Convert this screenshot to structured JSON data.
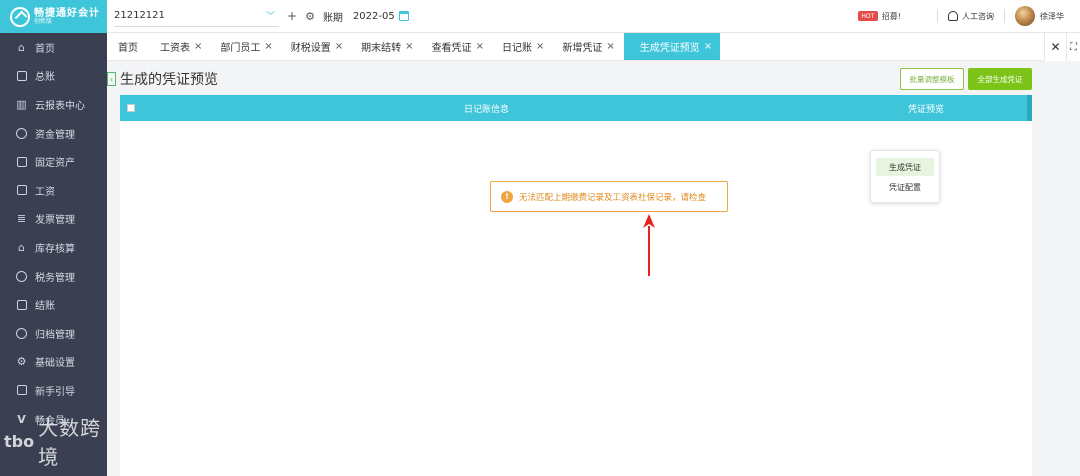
{
  "app": {
    "title": "畅捷通好会计",
    "subtitle": "创新版"
  },
  "sidebar": {
    "items": [
      {
        "label": "首页",
        "icon": "home-icon"
      },
      {
        "label": "总账",
        "icon": "ledger-icon"
      },
      {
        "label": "云报表中心",
        "icon": "chart-icon"
      },
      {
        "label": "资金管理",
        "icon": "money-icon"
      },
      {
        "label": "固定资产",
        "icon": "asset-icon"
      },
      {
        "label": "工资",
        "icon": "salary-icon"
      },
      {
        "label": "发票管理",
        "icon": "invoice-icon"
      },
      {
        "label": "库存核算",
        "icon": "warehouse-icon"
      },
      {
        "label": "税务管理",
        "icon": "tax-icon"
      },
      {
        "label": "结账",
        "icon": "checkout-icon"
      },
      {
        "label": "归档管理",
        "icon": "archive-icon"
      },
      {
        "label": "基础设置",
        "icon": "settings-icon"
      },
      {
        "label": "新手引导",
        "icon": "guide-icon"
      },
      {
        "label": "畅会员",
        "icon": "member-icon"
      }
    ]
  },
  "topbar": {
    "company": "21212121",
    "period_label": "账期",
    "period_value": "2022-05",
    "recruit_badge": "HOT",
    "recruit_label": "招募!",
    "support_label": "人工咨询",
    "user_name": "徐泽华"
  },
  "tabs": [
    {
      "label": "首页",
      "closable": false
    },
    {
      "label": "工资表",
      "closable": true
    },
    {
      "label": "部门员工",
      "closable": true
    },
    {
      "label": "财税设置",
      "closable": true
    },
    {
      "label": "期末结转",
      "closable": true
    },
    {
      "label": "查看凭证",
      "closable": true
    },
    {
      "label": "日记账",
      "closable": true
    },
    {
      "label": "新增凭证",
      "closable": true
    },
    {
      "label": "生成凭证预览",
      "closable": true,
      "active": true
    }
  ],
  "page": {
    "title": "生成的凭证预览",
    "btn_batch": "批量调整模板",
    "btn_all": "全部生成凭证",
    "table_headers": [
      "日记账信息",
      "凭证预览"
    ],
    "warning": "无法匹配上期缴费记录及工资表社保记录，请检查",
    "dropdown": [
      "生成凭证",
      "凭证配置"
    ]
  },
  "watermark": {
    "logo": "tbo",
    "text": "大数跨境"
  },
  "colors": {
    "accent": "#3ec5da",
    "sidebar": "#3a3f51",
    "primary_button": "#7cc418",
    "warning": "#f0a540",
    "arrow": "#e8231b"
  }
}
